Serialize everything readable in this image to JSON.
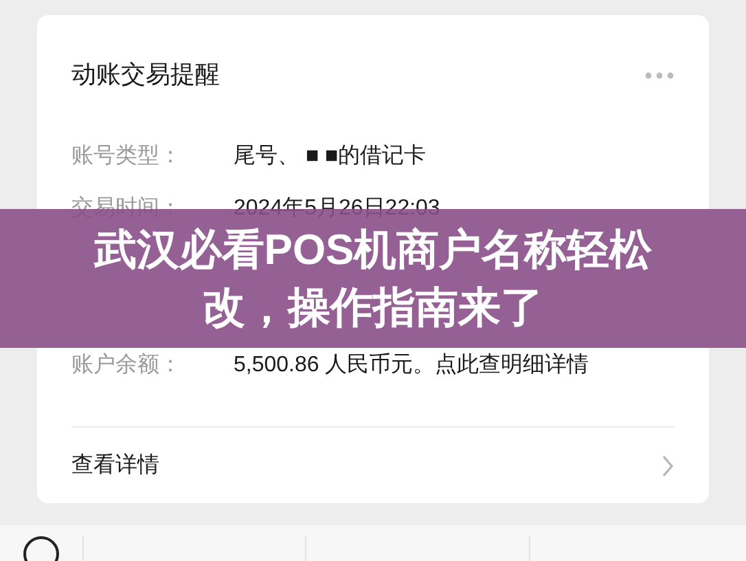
{
  "card": {
    "title": "动账交易提醒",
    "rows": [
      {
        "label": "账号类型：",
        "value": "尾号、 ■ ■的借记卡"
      },
      {
        "label": "交易时间：",
        "value": "2024年5月26日22:03"
      }
    ],
    "balance_row": {
      "label": "账户余额：",
      "value": "5,500.86 人民币元。点此查明细详情"
    },
    "details_link": "查看详情"
  },
  "banner": {
    "title": "武汉必看POS机商户名称轻松改，操作指南来了"
  }
}
